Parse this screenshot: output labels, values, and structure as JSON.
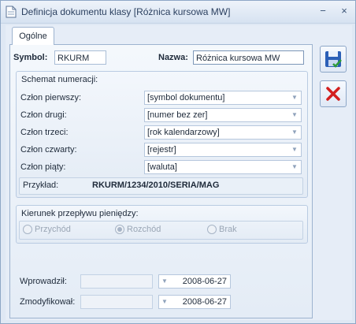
{
  "window": {
    "title": "Definicja dokumentu klasy [Różnica kursowa MW]",
    "minimize_glyph": "−",
    "close_glyph": "×"
  },
  "tabs": [
    {
      "label": "Ogólne",
      "active": true
    }
  ],
  "symbol": {
    "label": "Symbol:",
    "value": "RKURM"
  },
  "nazwa": {
    "label": "Nazwa:",
    "value": "Różnica kursowa MW"
  },
  "schemat": {
    "title": "Schemat numeracji:",
    "rows": [
      {
        "label": "Człon pierwszy:",
        "value": "[symbol dokumentu]"
      },
      {
        "label": "Człon drugi:",
        "value": "[numer bez zer]"
      },
      {
        "label": "Człon trzeci:",
        "value": "[rok kalendarzowy]"
      },
      {
        "label": "Człon czwarty:",
        "value": "[rejestr]"
      },
      {
        "label": "Człon piąty:",
        "value": "[waluta]"
      }
    ],
    "example_label": "Przykład:",
    "example_value": "RKURM/1234/2010/SERIA/MAG"
  },
  "kierunek": {
    "title": "Kierunek przepływu pieniędzy:",
    "options": [
      {
        "label": "Przychód",
        "selected": false
      },
      {
        "label": "Rozchód",
        "selected": true
      },
      {
        "label": "Brak",
        "selected": false
      }
    ]
  },
  "audit": {
    "wprowadzil_label": "Wprowadził:",
    "wprowadzil_user": "",
    "wprowadzil_date": "2008-06-27",
    "zmodyfikowal_label": "Zmodyfikował:",
    "zmodyfikowal_user": "",
    "zmodyfikowal_date": "2008-06-27"
  },
  "actions": {
    "save_icon": "save-icon",
    "cancel_icon": "cancel-icon"
  },
  "colors": {
    "accent": "#2a3f5f",
    "cancel_red": "#d31f1f",
    "save_blue": "#2b5fb7"
  }
}
